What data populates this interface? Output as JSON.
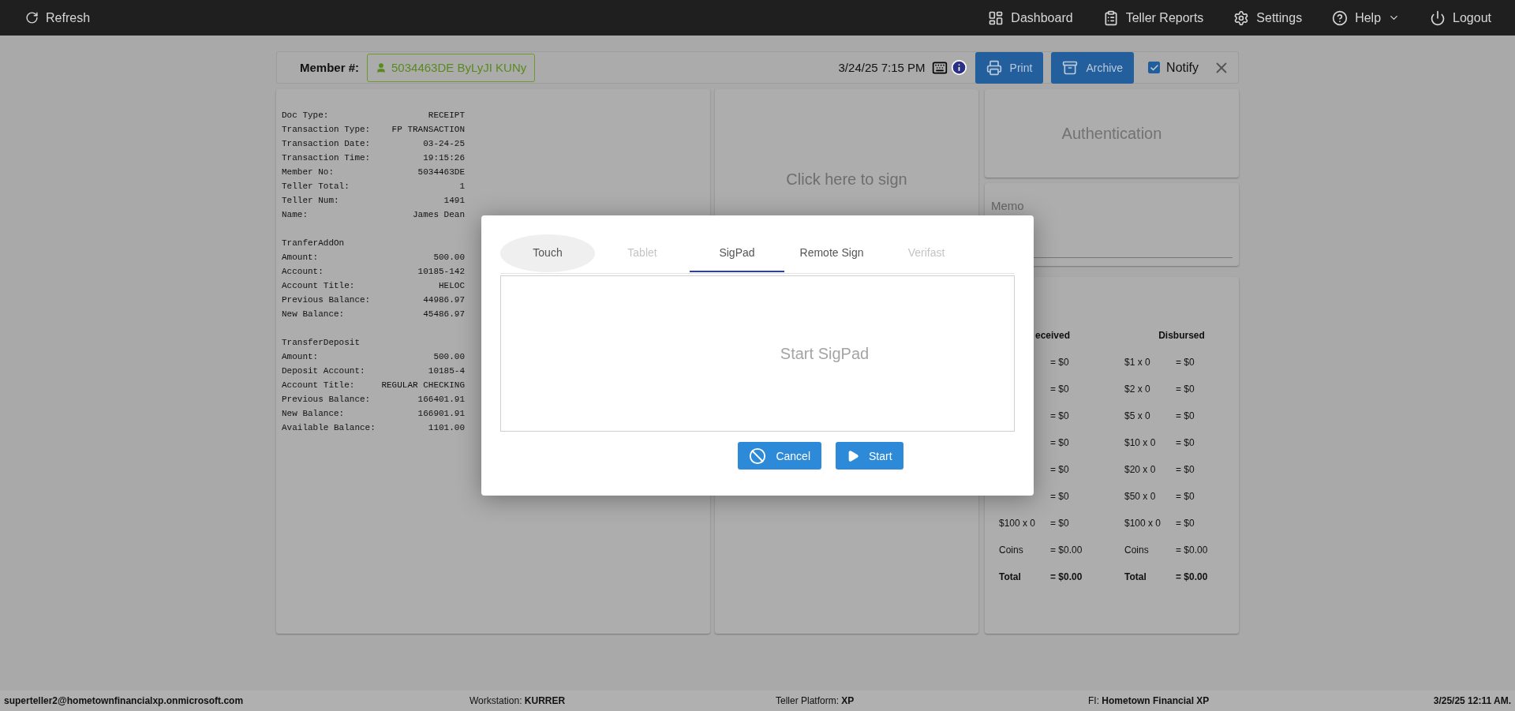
{
  "topbar": {
    "left": {
      "label": "Refresh"
    },
    "items": [
      {
        "label": "Dashboard",
        "has_menu": false
      },
      {
        "label": "Teller Reports",
        "has_menu": false
      },
      {
        "label": "Settings",
        "has_menu": false
      },
      {
        "label": "Help",
        "has_menu": true
      },
      {
        "label": "Logout",
        "has_menu": false
      }
    ]
  },
  "header": {
    "member_label": "Member #:",
    "member_value": "5034463DE ByLyJI KUNy",
    "datetime": "3/24/25 7:15 PM",
    "buttons": [
      {
        "label": "Print"
      },
      {
        "label": "Archive"
      }
    ],
    "notify": {
      "label": "Notify",
      "checked": true
    }
  },
  "receipt": [
    {
      "rows": [
        {
          "label": "Doc Type:",
          "value": "RECEIPT"
        },
        {
          "label": "Transaction Type:",
          "value": "FP TRANSACTION"
        },
        {
          "label": "Transaction Date:",
          "value": "03-24-25"
        },
        {
          "label": "Transaction Time:",
          "value": "19:15:26"
        },
        {
          "label": "Member No:",
          "value": "5034463DE"
        },
        {
          "label": "Teller Total:",
          "value": "1"
        },
        {
          "label": "Teller Num:",
          "value": "1491"
        },
        {
          "label": "Name:",
          "value": "James Dean"
        }
      ]
    },
    {
      "title": "TranferAddOn",
      "rows": [
        {
          "label": "Amount:",
          "value": "500.00"
        },
        {
          "label": "Account:",
          "value": "10185-142"
        },
        {
          "label": "Account Title:",
          "value": "HELOC"
        },
        {
          "label": "Previous Balance:",
          "value": "44986.97"
        },
        {
          "label": "New Balance:",
          "value": "45486.97"
        }
      ]
    },
    {
      "title": "TransferDeposit",
      "rows": [
        {
          "label": "Amount:",
          "value": "500.00"
        },
        {
          "label": "Deposit Account:",
          "value": "10185-4"
        },
        {
          "label": "Account Title:",
          "value": "REGULAR CHECKING"
        },
        {
          "label": "Previous Balance:",
          "value": "166401.91"
        },
        {
          "label": "New Balance:",
          "value": "166901.91"
        },
        {
          "label": "Available Balance:",
          "value": "1101.00"
        }
      ]
    }
  ],
  "signature": {
    "prompt": "Click here to sign"
  },
  "authentication": {
    "title": "Authentication"
  },
  "memo": {
    "label": "Memo"
  },
  "cash": {
    "received": {
      "header": "eceived",
      "rows": [
        {
          "kind": "amount",
          "value": "= $0"
        },
        {
          "kind": "amount",
          "value": "= $0"
        },
        {
          "kind": "amount",
          "value": "= $0"
        },
        {
          "kind": "amount",
          "value": "= $0"
        },
        {
          "kind": "amount",
          "value": "= $0"
        },
        {
          "kind": "amount",
          "value": "= $0"
        },
        {
          "kind": "amount",
          "label": "$100 x 0",
          "value": "= $0"
        },
        {
          "kind": "amount",
          "label": "Coins",
          "value": "= $0.00"
        },
        {
          "kind": "total",
          "label": "Total",
          "value": "= $0.00"
        }
      ]
    },
    "disbursed": {
      "header": "Disbursed",
      "rows": [
        {
          "kind": "amount",
          "label": "$1 x 0",
          "value": "= $0"
        },
        {
          "kind": "amount",
          "label": "$2 x 0",
          "value": "= $0"
        },
        {
          "kind": "amount",
          "label": "$5 x 0",
          "value": "= $0"
        },
        {
          "kind": "amount",
          "label": "$10 x 0",
          "value": "= $0"
        },
        {
          "kind": "amount",
          "label": "$20 x 0",
          "value": "= $0"
        },
        {
          "kind": "amount",
          "label": "$50 x 0",
          "value": "= $0"
        },
        {
          "kind": "amount",
          "label": "$100 x 0",
          "value": "= $0"
        },
        {
          "kind": "amount",
          "label": "Coins",
          "value": "= $0.00"
        },
        {
          "kind": "total",
          "label": "Total",
          "value": "= $0.00"
        }
      ]
    }
  },
  "modal": {
    "tabs": [
      {
        "label": "Touch",
        "selected": false,
        "disabled": false,
        "focused": true
      },
      {
        "label": "Tablet",
        "selected": false,
        "disabled": true,
        "focused": false
      },
      {
        "label": "SigPad",
        "selected": true,
        "disabled": false,
        "focused": false
      },
      {
        "label": "Remote Sign",
        "selected": false,
        "disabled": false,
        "focused": false
      },
      {
        "label": "Verifast",
        "selected": false,
        "disabled": true,
        "focused": false
      }
    ],
    "pad_prompt": "Start SigPad",
    "buttons": [
      {
        "kind": "cancel",
        "label": "Cancel"
      },
      {
        "kind": "start",
        "label": "Start"
      }
    ]
  },
  "status_bar": {
    "user": "superteller2@hometownfinancialxp.onmicrosoft.com",
    "workstation": "Workstation: **KURRER**",
    "platform": "Teller Platform: **XP**",
    "fi": "FI: **Hometown Financial XP**",
    "datetime": "3/25/25 12:11 AM."
  }
}
